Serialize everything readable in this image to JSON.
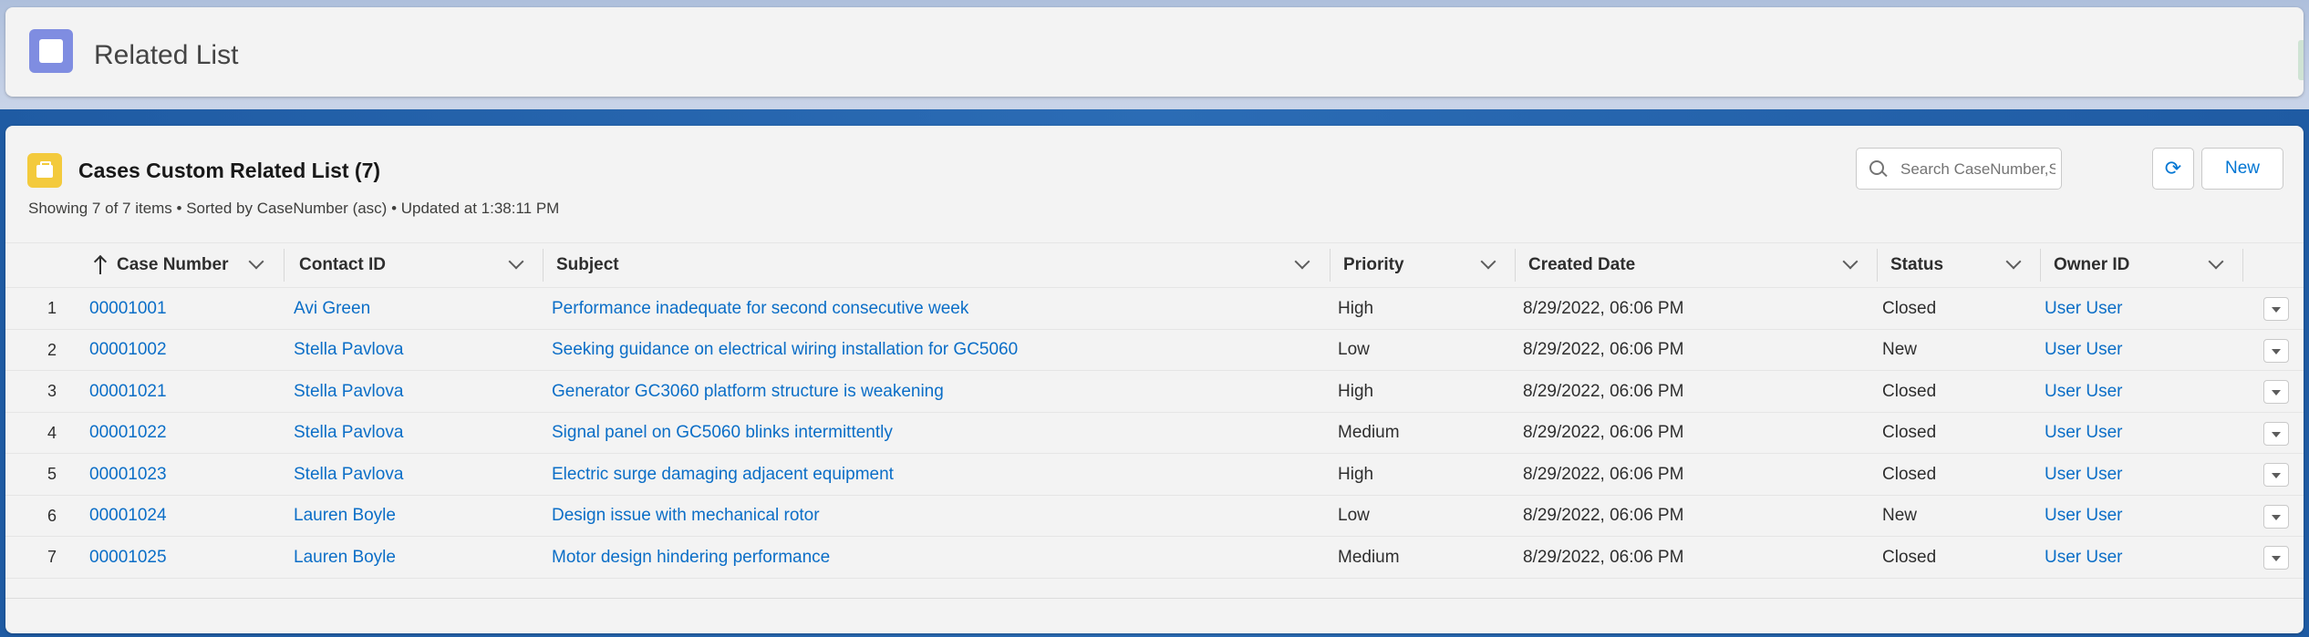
{
  "header": {
    "title": "Related List"
  },
  "list": {
    "title": "Cases Custom Related List (7)",
    "subtitle": "Showing 7 of 7 items • Sorted by CaseNumber (asc) • Updated at 1:38:11 PM",
    "search_placeholder": "Search CaseNumber,Subject",
    "refresh_label": "⟳",
    "new_label": "New"
  },
  "columns": {
    "case_number": "Case Number",
    "contact_id": "Contact ID",
    "subject": "Subject",
    "priority": "Priority",
    "created_date": "Created Date",
    "status": "Status",
    "owner_id": "Owner ID"
  },
  "rows": [
    {
      "n": "1",
      "case_number": "00001001",
      "contact": "Avi Green",
      "subject": "Performance inadequate for second consecutive week",
      "priority": "High",
      "created": "8/29/2022, 06:06 PM",
      "status": "Closed",
      "owner": "User User"
    },
    {
      "n": "2",
      "case_number": "00001002",
      "contact": "Stella Pavlova",
      "subject": "Seeking guidance on electrical wiring installation for GC5060",
      "priority": "Low",
      "created": "8/29/2022, 06:06 PM",
      "status": "New",
      "owner": "User User"
    },
    {
      "n": "3",
      "case_number": "00001021",
      "contact": "Stella Pavlova",
      "subject": "Generator GC3060 platform structure is weakening",
      "priority": "High",
      "created": "8/29/2022, 06:06 PM",
      "status": "Closed",
      "owner": "User User"
    },
    {
      "n": "4",
      "case_number": "00001022",
      "contact": "Stella Pavlova",
      "subject": "Signal panel on GC5060 blinks intermittently",
      "priority": "Medium",
      "created": "8/29/2022, 06:06 PM",
      "status": "Closed",
      "owner": "User User"
    },
    {
      "n": "5",
      "case_number": "00001023",
      "contact": "Stella Pavlova",
      "subject": "Electric surge damaging adjacent equipment",
      "priority": "High",
      "created": "8/29/2022, 06:06 PM",
      "status": "Closed",
      "owner": "User User"
    },
    {
      "n": "6",
      "case_number": "00001024",
      "contact": "Lauren Boyle",
      "subject": "Design issue with mechanical rotor",
      "priority": "Low",
      "created": "8/29/2022, 06:06 PM",
      "status": "New",
      "owner": "User User"
    },
    {
      "n": "7",
      "case_number": "00001025",
      "contact": "Lauren Boyle",
      "subject": "Motor design hindering performance",
      "priority": "Medium",
      "created": "8/29/2022, 06:06 PM",
      "status": "Closed",
      "owner": "User User"
    }
  ],
  "colors": {
    "link": "#0b6ec7",
    "brand_icon": "#7f8de1",
    "case_icon": "#f3ca3c"
  }
}
